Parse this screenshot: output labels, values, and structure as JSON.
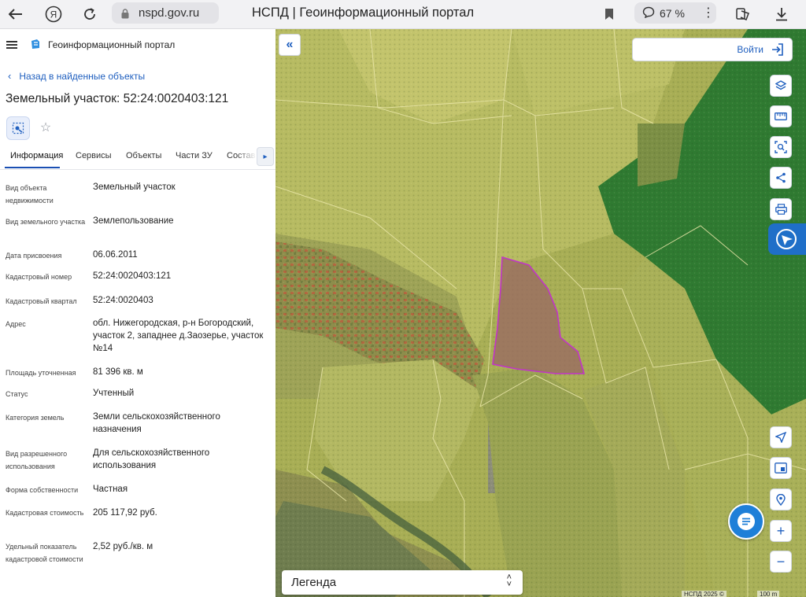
{
  "browser": {
    "url": "nspd.gov.ru",
    "title": "НСПД | Геоинформационный портал",
    "zoom": "67 %"
  },
  "portal": {
    "name": "Геоинформационный портал"
  },
  "back_link": "Назад в найденные объекты",
  "parcel_title": "Земельный участок: 52:24:0020403:121",
  "tabs": [
    "Информация",
    "Сервисы",
    "Объекты",
    "Части ЗУ",
    "Состав"
  ],
  "active_tab": "Информация",
  "info": [
    {
      "label": "Вид объекта недвижимости",
      "value": "Земельный участок"
    },
    {
      "label": "Вид земельного участка",
      "value": "Землепользование"
    },
    {
      "label": "Дата присвоения",
      "value": "06.06.2011"
    },
    {
      "label": "Кадастровый номер",
      "value": "52:24:0020403:121"
    },
    {
      "label": "Кадастровый квартал",
      "value": "52:24:0020403"
    },
    {
      "label": "Адрес",
      "value": "обл. Нижегородская, р-н Богородский, участок 2, западнее д.Заозерье, участок №14"
    },
    {
      "label": "Площадь уточненная",
      "value": "81 396 кв. м"
    },
    {
      "label": "Статус",
      "value": "Учтенный"
    },
    {
      "label": "Категория земель",
      "value": "Земли сельскохозяйственного назначения"
    },
    {
      "label": "Вид разрешенного использования",
      "value": "Для сельскохозяйственного использования"
    },
    {
      "label": "Форма собственности",
      "value": "Частная"
    },
    {
      "label": "Кадастровая стоимость",
      "value": "205 117,92 руб."
    },
    {
      "label": "Удельный показатель кадастровой стоимости",
      "value": "2,52 руб./кв. м"
    }
  ],
  "map": {
    "login_label": "Войти",
    "legend_label": "Легенда",
    "attribution": "НСПД 2025 ©",
    "scale": "100 m",
    "colors": {
      "parcel_fill": "#9a6b62",
      "parcel_stroke": "#c234c8",
      "forest": "#2e7a2f",
      "field": "#b9bd5e",
      "accent": "#1e7fd8"
    },
    "top_tools": [
      "layers-icon",
      "ruler-icon",
      "select-area-icon",
      "share-icon",
      "print-icon"
    ],
    "bottom_tools": [
      "geolocation-icon",
      "mini-map-icon",
      "find-on-map-icon",
      "zoom-in-icon",
      "zoom-out-icon"
    ]
  }
}
